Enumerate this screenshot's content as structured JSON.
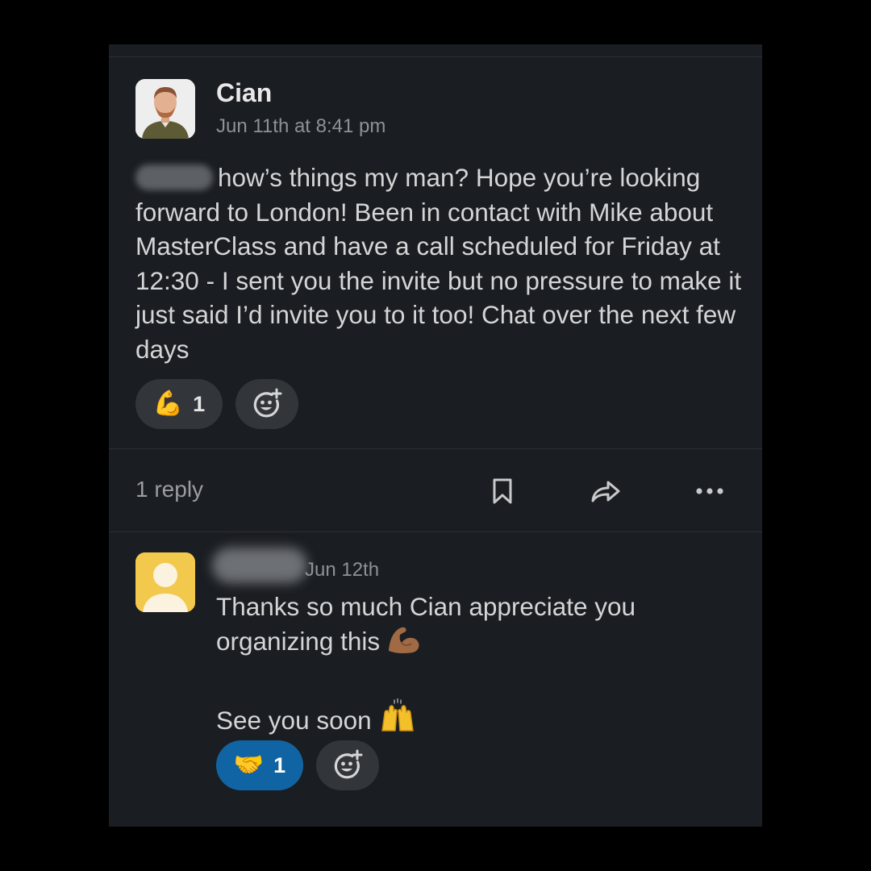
{
  "message": {
    "sender": "Cian",
    "timestamp": "Jun 11th at 8:41 pm",
    "text": "how’s things my man? Hope you’re looking forward to London! Been in contact with Mike about MasterClass and have a call scheduled for Friday at 12:30 - I sent you the invite but no pressure to make it just said I’d invite you to it too! Chat over the next few days",
    "reactions": [
      {
        "emoji": "💪",
        "emoji_name": "flexed-biceps",
        "count": "1"
      }
    ],
    "add_reaction_icon": "add-reaction-icon"
  },
  "thread_bar": {
    "reply_count": "1 reply",
    "icons": [
      "bookmark-icon",
      "share-icon",
      "more-icon"
    ]
  },
  "reply": {
    "timestamp": "Jun 12th",
    "line1": "Thanks so much Cian appreciate you organizing this",
    "line1_emoji": "flexed-biceps-medium-dark",
    "line2": "See you soon",
    "line2_emoji": "raising-hands",
    "reactions": [
      {
        "emoji": "🤝",
        "emoji_name": "handshake",
        "count": "1",
        "active": true
      }
    ]
  },
  "colors": {
    "page_background": "#000000",
    "panel_background": "#1a1d21",
    "reaction_pill": "#32363b",
    "active_reaction": "#1164a3",
    "reply_avatar": "#f2c94c"
  }
}
